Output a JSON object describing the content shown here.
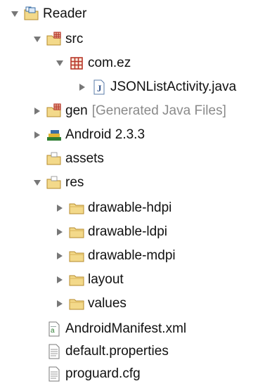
{
  "tree": {
    "project": {
      "label": "Reader",
      "expanded": true,
      "icon": "project-folder-icon"
    },
    "src": {
      "label": "src",
      "expanded": true,
      "icon": "source-folder-icon"
    },
    "package": {
      "label": "com.ez",
      "expanded": true,
      "icon": "package-icon"
    },
    "java_file": {
      "label": "JSONListActivity.java",
      "expanded": false,
      "icon": "java-file-icon"
    },
    "gen": {
      "label": "gen",
      "decoration": "[Generated Java Files]",
      "expanded": false,
      "icon": "generated-folder-icon"
    },
    "android": {
      "label": "Android 2.3.3",
      "expanded": false,
      "icon": "library-icon"
    },
    "assets": {
      "label": "assets",
      "icon": "folder-icon"
    },
    "res": {
      "label": "res",
      "expanded": true,
      "icon": "resource-folder-icon"
    },
    "res_children": [
      {
        "label": "drawable-hdpi",
        "icon": "folder-icon"
      },
      {
        "label": "drawable-ldpi",
        "icon": "folder-icon"
      },
      {
        "label": "drawable-mdpi",
        "icon": "folder-icon"
      },
      {
        "label": "layout",
        "icon": "folder-icon"
      },
      {
        "label": "values",
        "icon": "folder-icon"
      }
    ],
    "files": [
      {
        "label": "AndroidManifest.xml",
        "icon": "xml-file-icon"
      },
      {
        "label": "default.properties",
        "icon": "text-file-icon"
      },
      {
        "label": "proguard.cfg",
        "icon": "text-file-icon"
      }
    ]
  },
  "colors": {
    "disclosure": "#777777",
    "folder_fill": "#f3d98a",
    "folder_stroke": "#b48a2c",
    "package_red": "#b8372a",
    "library_green": "#2e7d32",
    "library_yellow": "#e2b533",
    "text": "#111111",
    "decoration": "#8a8a8a"
  }
}
